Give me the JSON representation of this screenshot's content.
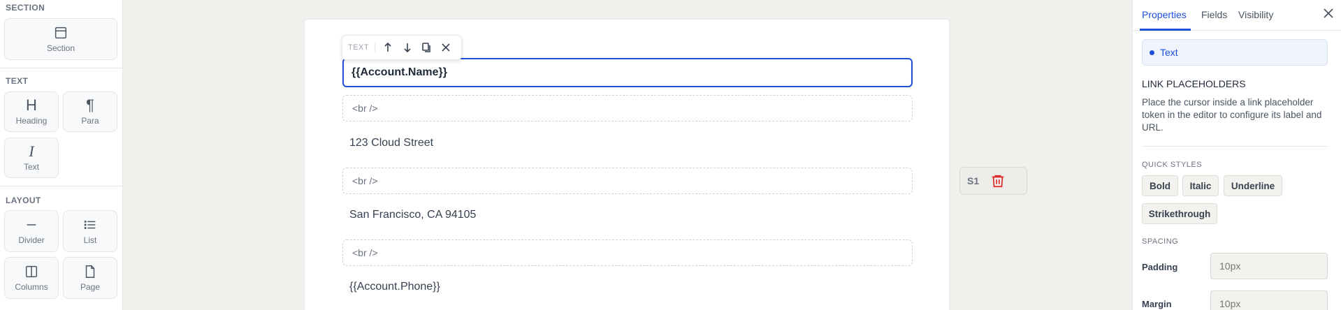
{
  "palette": {
    "section": {
      "heading": "SECTION",
      "items": [
        {
          "label": "Section",
          "icon": "section-icon"
        }
      ]
    },
    "text": {
      "heading": "TEXT",
      "items": [
        {
          "label": "Heading",
          "icon": "heading-icon",
          "glyph": "H"
        },
        {
          "label": "Para",
          "icon": "paragraph-icon",
          "glyph": "¶"
        },
        {
          "label": "Text",
          "icon": "text-icon",
          "glyph": "I"
        }
      ]
    },
    "layout": {
      "heading": "LAYOUT",
      "items": [
        {
          "label": "Divider",
          "icon": "divider-icon"
        },
        {
          "label": "List",
          "icon": "list-icon"
        },
        {
          "label": "Columns",
          "icon": "columns-icon"
        },
        {
          "label": "Page",
          "icon": "page-icon"
        }
      ]
    }
  },
  "toolbar": {
    "label": "TEXT"
  },
  "canvas": {
    "blocks": [
      {
        "type": "active",
        "text": "{{Account.Name}}"
      },
      {
        "type": "br",
        "text": "<br />"
      },
      {
        "type": "text",
        "text": "123 Cloud Street"
      },
      {
        "type": "br",
        "text": "<br />"
      },
      {
        "type": "text",
        "text": "San Francisco, CA 94105"
      },
      {
        "type": "br",
        "text": "<br />"
      },
      {
        "type": "text",
        "text": "{{Account.Phone}}"
      }
    ]
  },
  "section_chip": {
    "id": "S1"
  },
  "panel": {
    "tabs": [
      {
        "label": "Properties",
        "active": true
      },
      {
        "label": "Fields"
      },
      {
        "label": "Visibility"
      }
    ],
    "selected_element": "Text",
    "link_placeholders": {
      "title": "LINK PLACEHOLDERS",
      "description": "Place the cursor inside a link placeholder token in the editor to configure its label and URL."
    },
    "quick_styles": {
      "title": "QUICK STYLES",
      "buttons": [
        "Bold",
        "Italic",
        "Underline",
        "Strikethrough"
      ]
    },
    "spacing": {
      "title": "SPACING",
      "padding": {
        "label": "Padding",
        "placeholder": "10px"
      },
      "margin": {
        "label": "Margin",
        "placeholder": "10px"
      }
    }
  },
  "colors": {
    "accent": "#1d4ed8",
    "danger": "#dc2626"
  }
}
